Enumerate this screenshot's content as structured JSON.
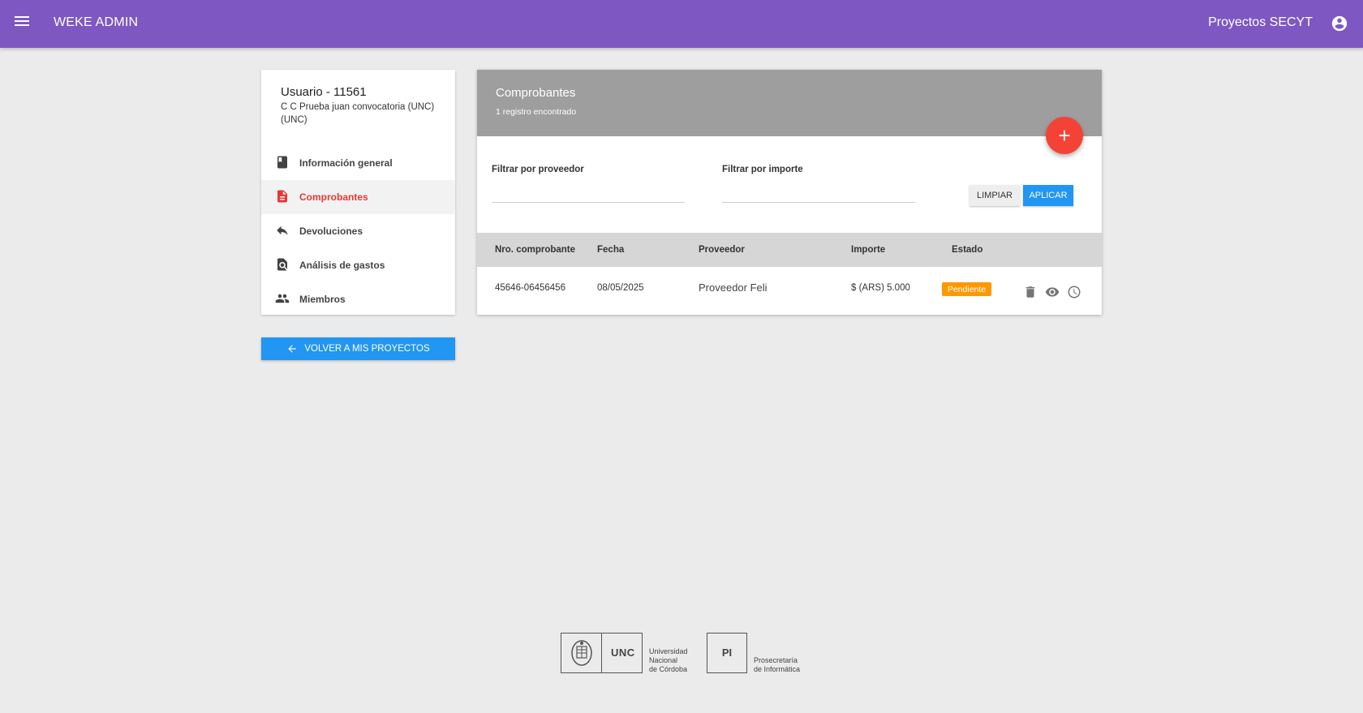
{
  "topbar": {
    "app_title": "WEKE ADMIN",
    "right_title": "Proyectos SECYT",
    "menu_icon": "menu-icon",
    "account_icon": "account-circle-icon",
    "color": "#7e57c2"
  },
  "user": {
    "title": "Usuario - 11561",
    "subtitle": "C C Prueba juan convocatoria (UNC) (UNC)"
  },
  "nav": {
    "items": [
      {
        "label": "Información general",
        "icon": "book-icon"
      },
      {
        "label": "Comprobantes",
        "icon": "document-icon",
        "active": true
      },
      {
        "label": "Devoluciones",
        "icon": "reply-icon"
      },
      {
        "label": "Análisis de gastos",
        "icon": "find-in-page-icon"
      },
      {
        "label": "Miembros",
        "icon": "people-icon"
      }
    ]
  },
  "back_button": {
    "label": "VOLVER A MIS PROYECTOS",
    "icon": "arrow-back-icon"
  },
  "main": {
    "title": "Comprobantes",
    "subtitle": "1 registro encontrado",
    "fab_label": "+",
    "filters": {
      "proveedor_label": "Filtrar por proveedor",
      "proveedor_value": "",
      "importe_label": "Filtrar por importe",
      "importe_value": "",
      "clear_label": "LIMPIAR",
      "apply_label": "APLICAR"
    },
    "table": {
      "headers": [
        "Nro. comprobante",
        "Fecha",
        "Proveedor",
        "Importe",
        "Estado"
      ],
      "rows": [
        {
          "nro": "45646-06456456",
          "fecha": "08/05/2025",
          "proveedor": "Proveedor Feli",
          "importe": "$ (ARS) 5.000",
          "estado": "Pendiente",
          "actions": [
            "delete-icon",
            "view-icon",
            "history-icon"
          ]
        }
      ]
    }
  },
  "footer": {
    "unc_abbr": "UNC",
    "unc_name_1": "Universidad",
    "unc_name_2": "Nacional",
    "unc_name_3": "de Córdoba",
    "pi_abbr": "PI",
    "pi_name_1": "Prosecretaría",
    "pi_name_2": "de Informática"
  },
  "colors": {
    "accent_red": "#f44336",
    "primary_blue": "#2196f3",
    "status_orange": "#ff9800",
    "header_gray": "#9e9e9e"
  }
}
